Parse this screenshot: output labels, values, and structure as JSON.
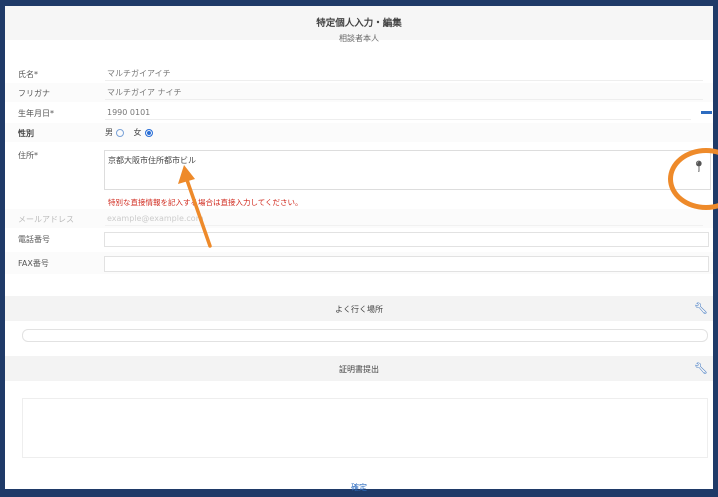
{
  "header": {
    "title": "特定個人入力・編集",
    "subtitle": "相談者本人"
  },
  "form": {
    "name_label": "氏名*",
    "name_value": "マルチガイアイチ",
    "kana_label": "フリガナ",
    "kana_value": "マルチガイア ナイチ",
    "birth_label": "生年月日*",
    "birth_value": "1990 0101",
    "gender_label": "性別",
    "gender_male": "男",
    "gender_female": "女",
    "gender_selected": "女",
    "address_label": "住所*",
    "address_value": "京都大阪市住所都市ビル",
    "address_warning": "特別な直接情報を記入する場合は直接入力してください。",
    "email_label": "メールアドレス",
    "email_value": "example@example.com",
    "phone_label": "電話番号",
    "fax_label": "FAX番号"
  },
  "sections": {
    "frequent_title": "よく行く場所",
    "support_title": "証明書提出"
  },
  "footer": {
    "link_label": "確定"
  },
  "icons": {
    "pin": "map-pin-icon",
    "collapse": "minus-icon",
    "edit": "wrench-icon"
  },
  "colors": {
    "border": "#1f3a68",
    "accent": "#2d6cc0",
    "warning": "#d0281c",
    "annotation": "#ee8a2a"
  }
}
